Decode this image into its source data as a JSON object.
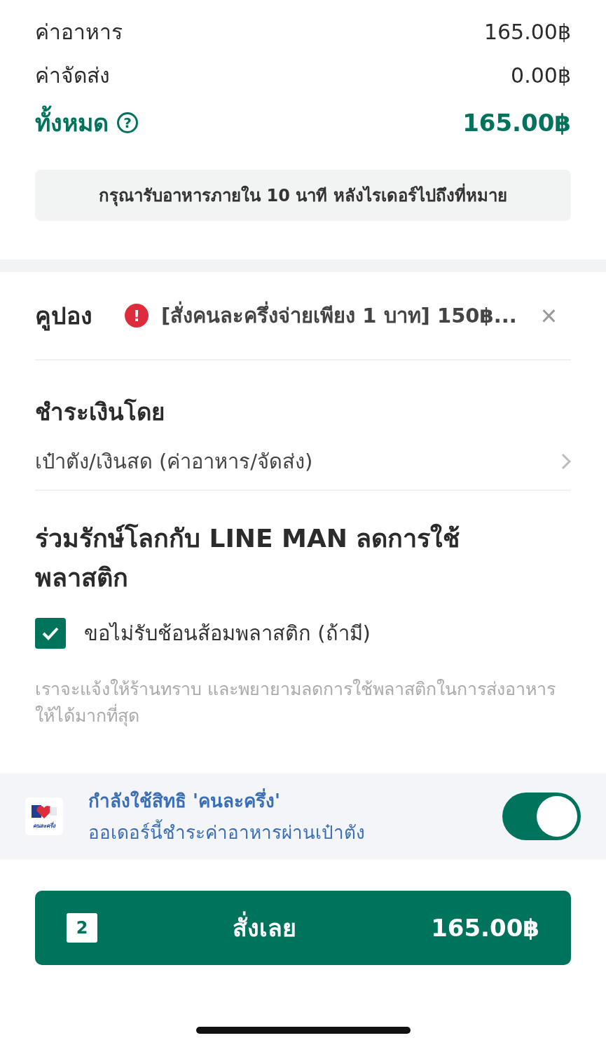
{
  "summary": {
    "rows": [
      {
        "label": "ค่าอาหาร",
        "value": "165.00฿"
      },
      {
        "label": "ค่าจัดส่ง",
        "value": "0.00฿"
      }
    ],
    "total": {
      "label": "ทั้งหมด",
      "help_icon": "?",
      "value": "165.00฿"
    },
    "notice": "กรุณารับอาหารภายใน 10 นาที หลังไรเดอร์ไปถึงที่หมาย"
  },
  "coupon": {
    "label": "คูปอง",
    "warning_icon": "!",
    "text": "[สั่งคนละครึ่งจ่ายเพียง 1 บาท] 150฿...",
    "remove": "×"
  },
  "payment": {
    "title": "ชำระเงินโดย",
    "method": "เป๋าตัง/เงินสด (ค่าอาหาร/จัดส่ง)"
  },
  "plastic": {
    "title": "ร่วมรักษ์โลกกับ LINE MAN ลดการใช้พลาสติก",
    "option": {
      "label": "ขอไม่รับช้อนส้อมพลาสติก (ถ้ามี)",
      "checked": true
    },
    "note": "เราจะแจ้งให้ร้านทราบ และพยายามลดการใช้พลาสติกในการส่งอาหารให้ได้มากที่สุด"
  },
  "program": {
    "logo_caption": "คนละครึ่ง",
    "title": "กำลังใช้สิทธิ 'คนละครึ่ง'",
    "subtitle": "ออเดอร์นี้ชำระค่าอาหารผ่านเป๋าตัง",
    "on": true
  },
  "order_button": {
    "count": "2",
    "label": "สั่งเลย",
    "price": "165.00฿"
  }
}
